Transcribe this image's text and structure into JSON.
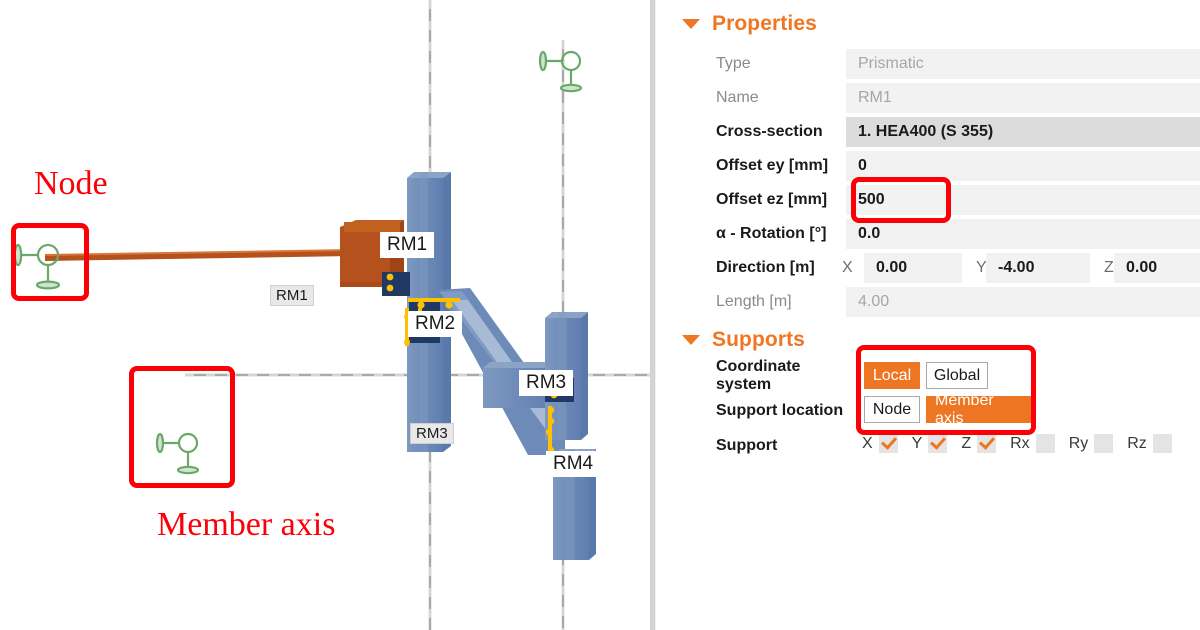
{
  "viewport": {
    "annotations": [
      {
        "name": "node",
        "text": "Node"
      },
      {
        "name": "member-axis",
        "text": "Member axis"
      }
    ],
    "member_tags": [
      {
        "name": "rm1-tag-white",
        "text": "RM1"
      },
      {
        "name": "rm2-tag-white",
        "text": "RM2"
      },
      {
        "name": "rm3-tag-white",
        "text": "RM3"
      },
      {
        "name": "rm4-tag-white",
        "text": "RM4"
      },
      {
        "name": "rm1-tag-gray",
        "text": "RM1"
      },
      {
        "name": "rm3-tag-gray",
        "text": "RM3"
      }
    ],
    "colors": {
      "member_blue": "#6d8ab8",
      "member_selected_orange": "#b4511c",
      "connection_navy": "#1f3864",
      "bolt_yellow": "#ffc000",
      "support_green": "#6aa86a",
      "axis_gray": "#a6a6a6",
      "annotation_red": "#fb0006"
    }
  },
  "panel": {
    "properties": {
      "title": "Properties",
      "caret": "caret-down-icon",
      "rows": [
        {
          "label": "Type",
          "value": "Prismatic",
          "dim_label": true,
          "dim_value": true,
          "selected": false
        },
        {
          "label": "Name",
          "value": "RM1",
          "dim_label": true,
          "dim_value": true,
          "selected": false
        },
        {
          "label": "Cross-section",
          "value": "1. HEA400 (S 355)",
          "dim_label": false,
          "dim_value": false,
          "selected": true
        },
        {
          "label": "Offset ey [mm]",
          "value": "0",
          "dim_label": false,
          "dim_value": false,
          "selected": false
        },
        {
          "label": "Offset ez [mm]",
          "value": "500",
          "dim_label": false,
          "dim_value": false,
          "selected": false
        },
        {
          "label": "α - Rotation [°]",
          "value": "0.0",
          "dim_label": false,
          "dim_value": false,
          "selected": false
        }
      ],
      "direction": {
        "label": "Direction [m]",
        "axes": [
          {
            "axis": "X",
            "value": "0.00"
          },
          {
            "axis": "Y",
            "value": "-4.00"
          },
          {
            "axis": "Z",
            "value": "0.00"
          }
        ]
      },
      "length": {
        "label": "Length [m]",
        "value": "4.00"
      }
    },
    "supports": {
      "title": "Supports",
      "caret": "caret-down-icon",
      "coordinate_system": {
        "label": "Coordinate system",
        "options": [
          {
            "label": "Local",
            "selected": true
          },
          {
            "label": "Global",
            "selected": false
          }
        ]
      },
      "support_location": {
        "label": "Support location",
        "options": [
          {
            "label": "Node",
            "selected": false
          },
          {
            "label": "Member axis",
            "selected": true
          }
        ]
      },
      "support": {
        "label": "Support",
        "dofs": [
          {
            "name": "X",
            "checked": true
          },
          {
            "name": "Y",
            "checked": true
          },
          {
            "name": "Z",
            "checked": true
          },
          {
            "name": "Rx",
            "checked": false
          },
          {
            "name": "Ry",
            "checked": false
          },
          {
            "name": "Rz",
            "checked": false
          }
        ]
      }
    }
  }
}
